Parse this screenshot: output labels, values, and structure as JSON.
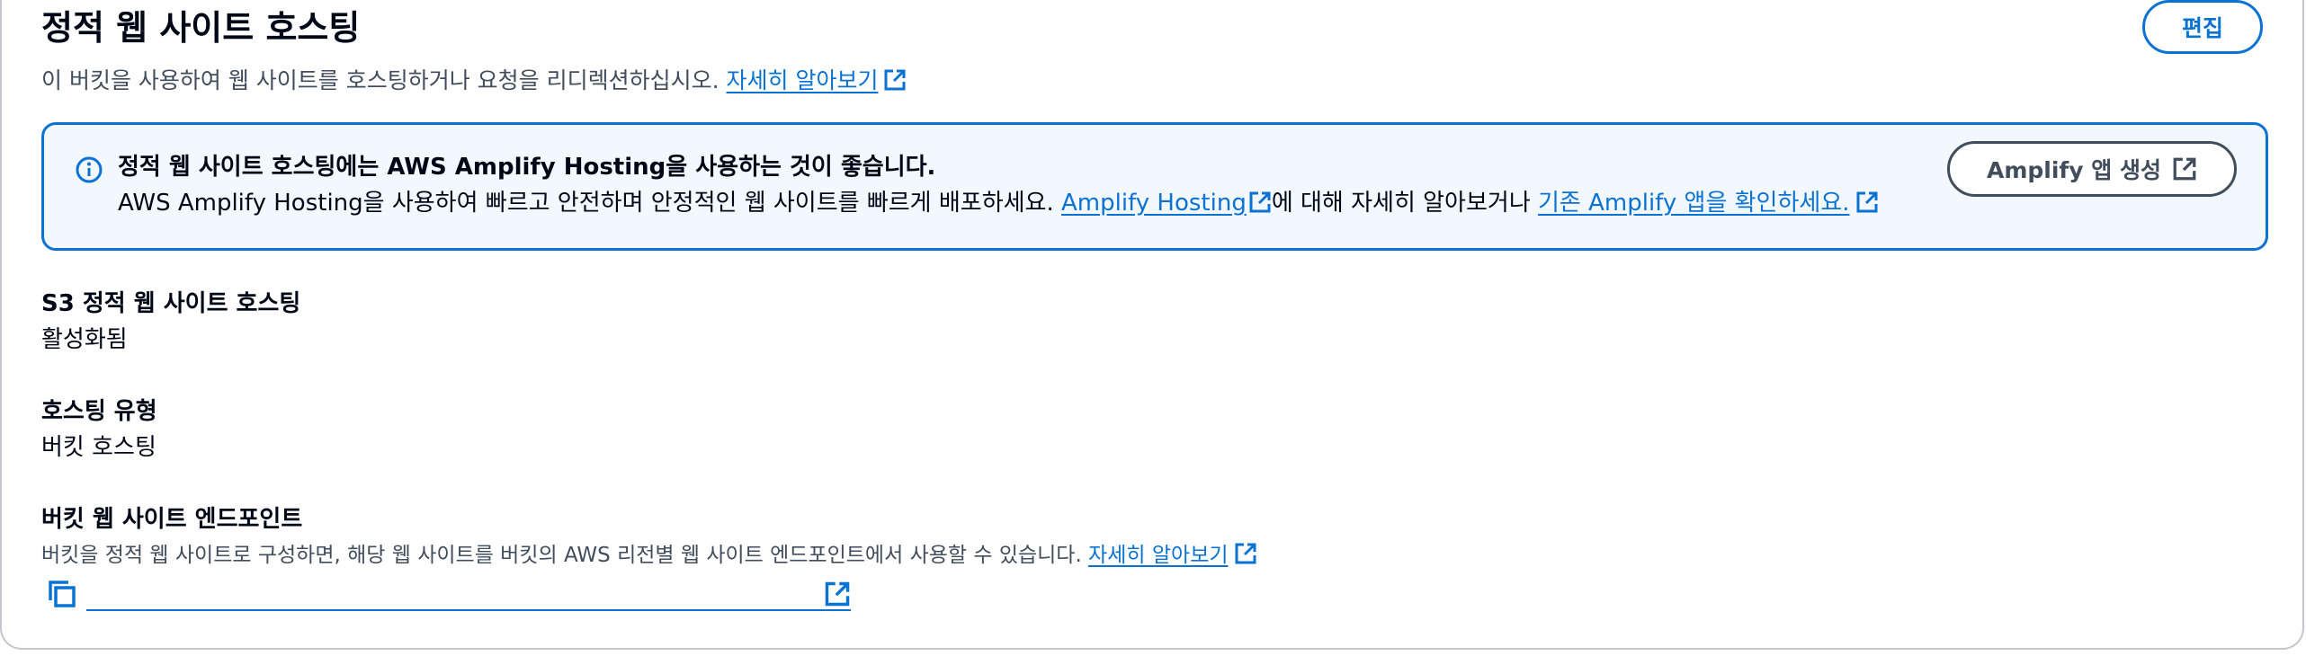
{
  "section": {
    "title": "정적 웹 사이트 호스팅",
    "edit_label": "편집",
    "description": "이 버킷을 사용하여 웹 사이트를 호스팅하거나 요청을 리디렉션하십시오.",
    "learn_more": "자세히 알아보기"
  },
  "alert": {
    "title": "정적 웹 사이트 호스팅에는 AWS Amplify Hosting을 사용하는 것이 좋습니다.",
    "body_prefix": "AWS Amplify Hosting을 사용하여 빠르고 안전하며 안정적인 웹 사이트를 빠르게 배포하세요.",
    "amplify_link": "Amplify Hosting",
    "body_middle": "에 대해 자세히 알아보거나",
    "existing_link": "기존 Amplify 앱을 확인하세요.",
    "button_label": "Amplify 앱 생성"
  },
  "fields": {
    "s3_hosting_label": "S3 정적 웹 사이트 호스팅",
    "s3_hosting_value": "활성화됨",
    "hosting_type_label": "호스팅 유형",
    "hosting_type_value": "버킷 호스팅",
    "endpoint_label": "버킷 웹 사이트 엔드포인트",
    "endpoint_description": "버킷을 정적 웹 사이트로 구성하면, 해당 웹 사이트를 버킷의 AWS 리전별 웹 사이트 엔드포인트에서 사용할 수 있습니다.",
    "endpoint_learn_more": "자세히 알아보기"
  },
  "icons": {
    "info": "info-icon",
    "external": "external-link-icon",
    "copy": "copy-icon"
  },
  "colors": {
    "link": "#0972d3",
    "alert_bg": "#f2f8fd",
    "alert_border": "#0972d3",
    "text": "#000716",
    "secondary_text": "#414d5c"
  }
}
